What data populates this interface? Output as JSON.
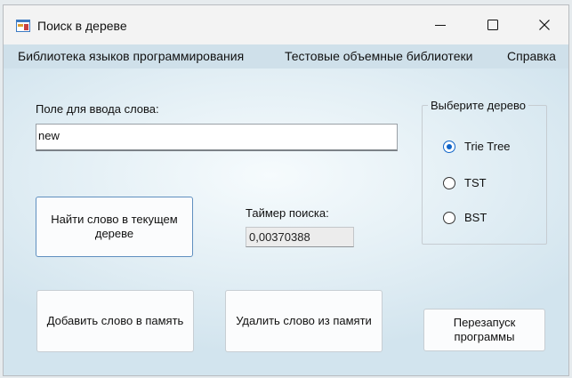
{
  "window": {
    "title": "Поиск в дереве",
    "controls": {
      "minimize": "—",
      "maximize": "☐",
      "close": "✕"
    }
  },
  "menu": {
    "items": [
      {
        "label": "Библиотека языков программирования"
      },
      {
        "label": "Тестовые объемные библиотеки"
      },
      {
        "label": "Справка"
      }
    ]
  },
  "form": {
    "input_label": "Поле для ввода слова:",
    "input_value": "new",
    "find_button": "Найти слово в текущем дереве",
    "timer_label": "Таймер поиска:",
    "timer_value": "0,00370388",
    "add_button": "Добавить слово в память",
    "delete_button": "Удалить слово из памяти",
    "restart_button": "Перезапуск программы"
  },
  "tree_group": {
    "title": "Выберите дерево",
    "options": [
      {
        "label": "Trie Tree",
        "checked": true
      },
      {
        "label": "TST",
        "checked": false
      },
      {
        "label": "BST",
        "checked": false
      }
    ]
  },
  "colors": {
    "menu_bg": "#cfe0ea",
    "accent": "#0f64c8",
    "primary_border": "#5f8fbf"
  }
}
